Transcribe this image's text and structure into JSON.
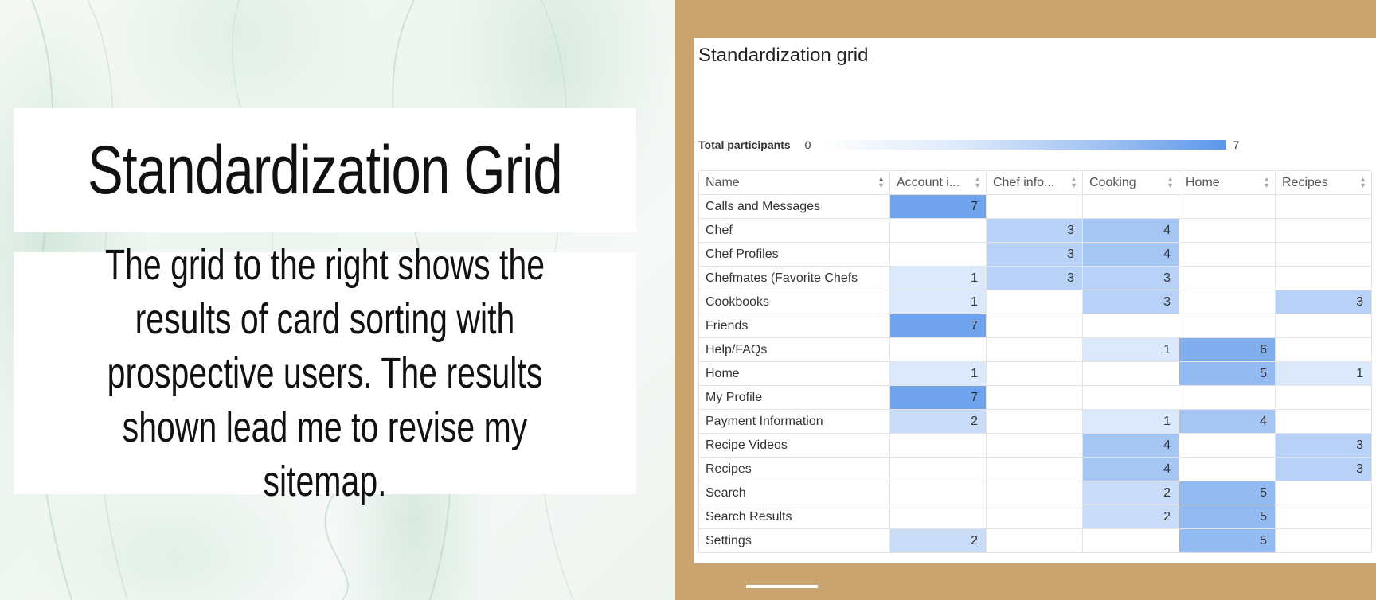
{
  "slide": {
    "title": "Standardization Grid",
    "body": "The grid to the right shows the results of card sorting with prospective users. The results shown lead me to revise my sitemap."
  },
  "grid": {
    "title": "Standardization grid",
    "participants": {
      "label": "Total participants",
      "min": "0",
      "max": "7"
    },
    "columns": [
      "Name",
      "Account i...",
      "Chef info...",
      "Cooking",
      "Home",
      "Recipes"
    ],
    "rows": [
      {
        "name": "Calls and Messages",
        "values": [
          "7",
          "",
          "",
          "",
          ""
        ]
      },
      {
        "name": "Chef",
        "values": [
          "",
          "3",
          "4",
          "",
          ""
        ]
      },
      {
        "name": "Chef Profiles",
        "values": [
          "",
          "3",
          "4",
          "",
          ""
        ]
      },
      {
        "name": "Chefmates (Favorite Chefs",
        "values": [
          "1",
          "3",
          "3",
          "",
          ""
        ]
      },
      {
        "name": "Cookbooks",
        "values": [
          "1",
          "",
          "3",
          "",
          "3"
        ]
      },
      {
        "name": "Friends",
        "values": [
          "7",
          "",
          "",
          "",
          ""
        ]
      },
      {
        "name": "Help/FAQs",
        "values": [
          "",
          "",
          "1",
          "6",
          ""
        ]
      },
      {
        "name": "Home",
        "values": [
          "1",
          "",
          "",
          "5",
          "1"
        ]
      },
      {
        "name": "My Profile",
        "values": [
          "7",
          "",
          "",
          "",
          ""
        ]
      },
      {
        "name": "Payment Information",
        "values": [
          "2",
          "",
          "1",
          "4",
          ""
        ]
      },
      {
        "name": "Recipe Videos",
        "values": [
          "",
          "",
          "4",
          "",
          "3"
        ]
      },
      {
        "name": "Recipes",
        "values": [
          "",
          "",
          "4",
          "",
          "3"
        ]
      },
      {
        "name": "Search",
        "values": [
          "",
          "",
          "2",
          "5",
          ""
        ]
      },
      {
        "name": "Search Results",
        "values": [
          "",
          "",
          "2",
          "5",
          ""
        ]
      },
      {
        "name": "Settings",
        "values": [
          "2",
          "",
          "",
          "5",
          ""
        ]
      }
    ],
    "max_value": 7,
    "colors": {
      "low": "#eef4fd",
      "high": "#6fa3ec",
      "panel": "#c9a46e"
    }
  }
}
